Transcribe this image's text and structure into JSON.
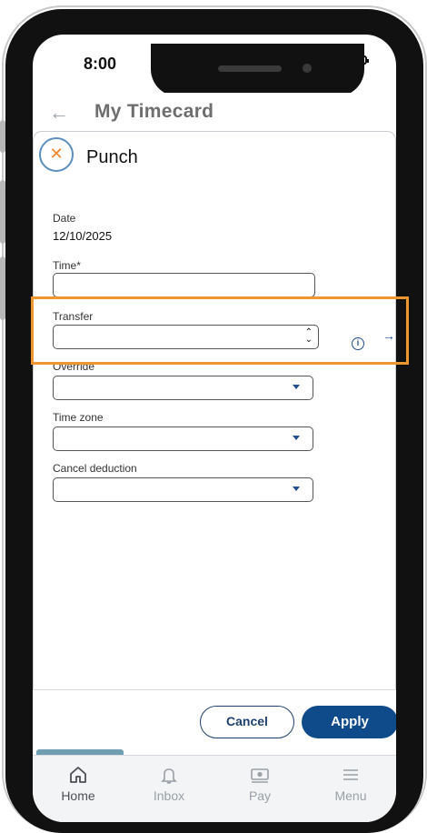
{
  "status_bar": {
    "time": "8:00"
  },
  "header": {
    "back_icon": "back-arrow-icon",
    "title": "My Timecard"
  },
  "dialog": {
    "close_icon": "close-icon",
    "title": "Punch",
    "fields": {
      "date": {
        "label": "Date",
        "value": "12/10/2025"
      },
      "time": {
        "label": "Time*",
        "value": ""
      },
      "transfer": {
        "label": "Transfer",
        "value": ""
      },
      "override": {
        "label": "Override",
        "value": ""
      },
      "time_zone": {
        "label": "Time zone",
        "value": ""
      },
      "cancel_deduction": {
        "label": "Cancel deduction",
        "value": ""
      }
    }
  },
  "actions": {
    "cancel": "Cancel",
    "apply": "Apply"
  },
  "tabs": [
    {
      "label": "Home",
      "icon": "home-icon",
      "active": true
    },
    {
      "label": "Inbox",
      "icon": "bell-icon",
      "active": false
    },
    {
      "label": "Pay",
      "icon": "money-icon",
      "active": false
    },
    {
      "label": "Menu",
      "icon": "menu-icon",
      "active": false
    }
  ],
  "colors": {
    "accent": "#0f4a8a",
    "highlight": "#f0962f",
    "close_x": "#f0862a"
  }
}
